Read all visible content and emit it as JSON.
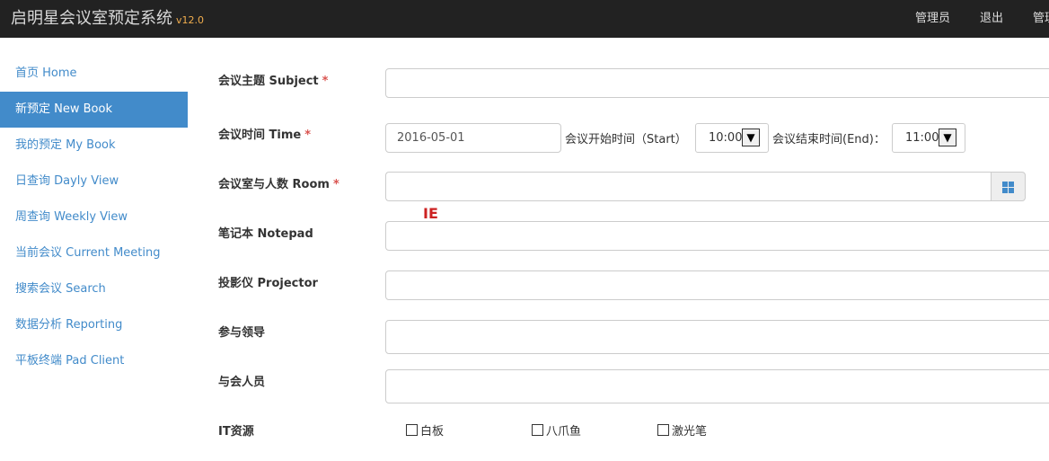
{
  "header": {
    "title": "启明星会议室预定系统",
    "version": "v12.0",
    "nav": {
      "admin": "管理员",
      "logout": "退出",
      "manage": "管理"
    }
  },
  "sidebar": {
    "items": [
      {
        "label": "首页 Home"
      },
      {
        "label": "新预定 New Book",
        "active": true
      },
      {
        "label": "我的预定 My Book"
      },
      {
        "label": "日查询 Dayly View"
      },
      {
        "label": "周查询 Weekly View"
      },
      {
        "label": "当前会议 Current Meeting"
      },
      {
        "label": "搜索会议 Search"
      },
      {
        "label": "数据分析 Reporting"
      },
      {
        "label": "平板终端 Pad Client"
      }
    ]
  },
  "form": {
    "subject": {
      "label": "会议主题 Subject",
      "required": "*",
      "value": ""
    },
    "time": {
      "label": "会议时间 Time",
      "required": "*",
      "date_value": "2016-05-01",
      "start_label": "会议开始时间（Start）",
      "start_value": "10:00",
      "end_label": "会议结束时间(End)：",
      "end_value": "11:00",
      "arrow": "▼"
    },
    "room": {
      "label": "会议室与人数 Room",
      "required": "*",
      "value": "",
      "picker_icon": "grid-icon"
    },
    "ie_note": "IE",
    "notepad": {
      "label": "笔记本 Notepad",
      "value": ""
    },
    "projector": {
      "label": "投影仪 Projector",
      "value": ""
    },
    "leaders": {
      "label": "参与领导",
      "value": ""
    },
    "attendees": {
      "label": "与会人员",
      "value": ""
    },
    "it_resources": {
      "label": "IT资源",
      "options": [
        {
          "label": "白板",
          "checked": false
        },
        {
          "label": "八爪鱼",
          "checked": false
        },
        {
          "label": "激光笔",
          "checked": false
        }
      ]
    }
  },
  "colors": {
    "navbar": "#222222",
    "primary": "#428bca",
    "required": "#d9534f",
    "ie_mark": "#cc2222"
  }
}
